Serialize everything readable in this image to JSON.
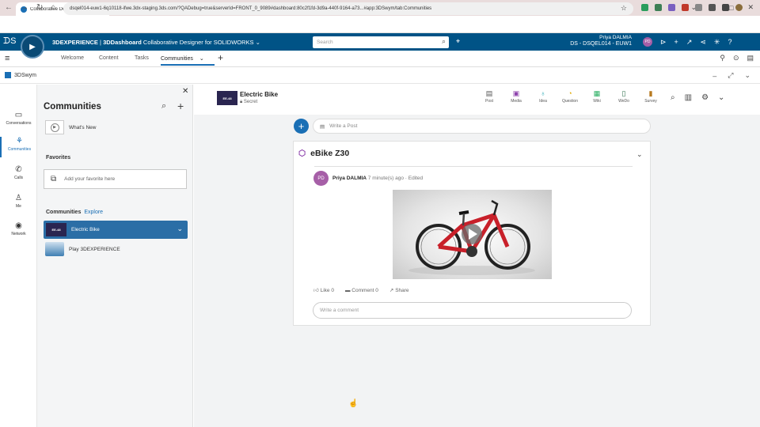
{
  "browser": {
    "tab_title": "Collaborative Designer for SOLI",
    "close": "✕",
    "new_tab": "+",
    "url": "dsqel014-euw1-6q10118-ifwe.3dx-staging.3ds.com/?QADebug=true&serverId=FRONT_0_9089#dashboard:80c2f1fd-3d9a-440f-9164-a73...#app:3DSwym/tab:Communities",
    "window_controls": [
      "⌄",
      "–",
      "□",
      "✕"
    ]
  },
  "header": {
    "brand": "3DEXPERIENCE",
    "brand_sep": " | ",
    "app": "3DDashboard",
    "app_suffix": " Collaborative Designer for SOLIDWORKS",
    "search_placeholder": "Search",
    "user_name": "Priya DALMIA",
    "tenant": "DS - DSQEL014 - EUW1",
    "avatar": "PD",
    "compass_label": "V.R"
  },
  "dashboard": {
    "tabs": [
      "Welcome",
      "Content",
      "Tasks",
      "Communities"
    ]
  },
  "widget": {
    "title": "3DSwym"
  },
  "leftnav": [
    {
      "label": "Conversations",
      "icon": "chat-icon"
    },
    {
      "label": "Communities",
      "icon": "communities-icon"
    },
    {
      "label": "Calls",
      "icon": "phone-icon"
    },
    {
      "label": "Me",
      "icon": "person-icon"
    },
    {
      "label": "Network",
      "icon": "network-icon"
    }
  ],
  "panel": {
    "title": "Communities",
    "whats_new": "What's New",
    "favorites_label": "Favorites",
    "favorites_placeholder": "Add your favorite here",
    "communities_label": "Communities",
    "explore": "Explore",
    "items": [
      {
        "label": "Electric Bike",
        "selected": true
      },
      {
        "label": "Play 3DEXPERIENCE",
        "selected": false
      }
    ]
  },
  "community": {
    "name": "Electric Bike",
    "privacy": "Secret",
    "logo_text": "EE-48",
    "actions": [
      {
        "label": "Post",
        "icon": "post-icon"
      },
      {
        "label": "Media",
        "icon": "media-icon"
      },
      {
        "label": "Idea",
        "icon": "idea-icon"
      },
      {
        "label": "Question",
        "icon": "question-icon"
      },
      {
        "label": "Wiki",
        "icon": "wiki-icon"
      },
      {
        "label": "WeDo",
        "icon": "wedo-icon"
      },
      {
        "label": "Survey",
        "icon": "survey-icon"
      }
    ]
  },
  "composer": {
    "placeholder": "Write a Post"
  },
  "post": {
    "title": "eBike Z30",
    "author_initials": "PD",
    "author": "Priya DALMIA",
    "meta": "7 minute(s) ago · Edited",
    "like": "Like",
    "like_count": "0",
    "comment": "Comment",
    "comment_count": "0",
    "share": "Share",
    "comment_placeholder": "Write a comment"
  },
  "colors": {
    "topbar": "#005386",
    "accent": "#1a6fb5",
    "avatar": "#a65fa7",
    "bike_frame": "#c8202a"
  }
}
